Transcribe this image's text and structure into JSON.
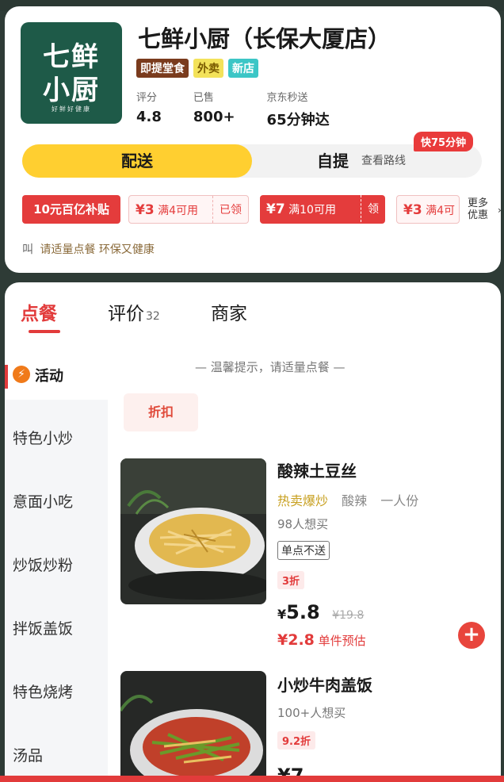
{
  "store": {
    "logo_line1": "七鲜",
    "logo_line2": "小厨",
    "logo_line3": "好鲜好健康",
    "name": "七鲜小厨（长保大厦店）",
    "tags": [
      "即提堂食",
      "外卖",
      "新店"
    ],
    "stats": [
      {
        "label": "评分",
        "value": "4.8"
      },
      {
        "label": "已售",
        "value": "800+"
      },
      {
        "label": "京东秒送",
        "value": "65分钟达"
      }
    ]
  },
  "delivery": {
    "delivery_label": "配送",
    "pickup_label": "自提",
    "route_label": "查看路线",
    "fast_badge": "快75分钟"
  },
  "coupons": {
    "subsidy": "10元百亿补贴",
    "items": [
      {
        "amount": "¥3",
        "cond": "满4可用",
        "state": "已领",
        "style": "outline"
      },
      {
        "amount": "¥7",
        "cond": "满10可用",
        "state": "领",
        "style": "filled"
      },
      {
        "amount": "¥3",
        "cond": "满4可",
        "state": "",
        "style": "outline"
      }
    ],
    "more_line1": "更多",
    "more_line2": "优惠"
  },
  "tip": {
    "prefix": "叫",
    "text": "请适量点餐 环保又健康"
  },
  "tabs": [
    {
      "label": "点餐",
      "count": ""
    },
    {
      "label": "评价",
      "count": "32"
    },
    {
      "label": "商家",
      "count": ""
    }
  ],
  "sidebar": {
    "active_label": "活动",
    "items": [
      "特色小炒",
      "意面小吃",
      "炒饭炒粉",
      "拌饭盖饭",
      "特色烧烤",
      "汤品"
    ]
  },
  "warm_tip": "— 温馨提示，请适量点餐 —",
  "discount_chip": "折扣",
  "dishes": [
    {
      "name": "酸辣土豆丝",
      "tag_hot": "热卖爆炒",
      "tag_taste": "酸辣",
      "tag_portion": "一人份",
      "sold": "98人想买",
      "limit": "单点不送",
      "discount": "3折",
      "price_symbol": "¥",
      "price": "5.8",
      "orig_price": "¥19.8",
      "est_price": "¥2.8",
      "est_label": "单件预估"
    },
    {
      "name": "小炒牛肉盖饭",
      "sold": "100+人想买",
      "discount": "9.2折",
      "price_partial": "¥7"
    }
  ],
  "colors": {
    "brand_green": "#1e5a48",
    "accent_red": "#e23b3b",
    "toggle_yellow": "#ffcf30"
  },
  "icons": {
    "activity": "flame-icon",
    "add": "plus-icon",
    "more": "chevron-right-icon"
  }
}
